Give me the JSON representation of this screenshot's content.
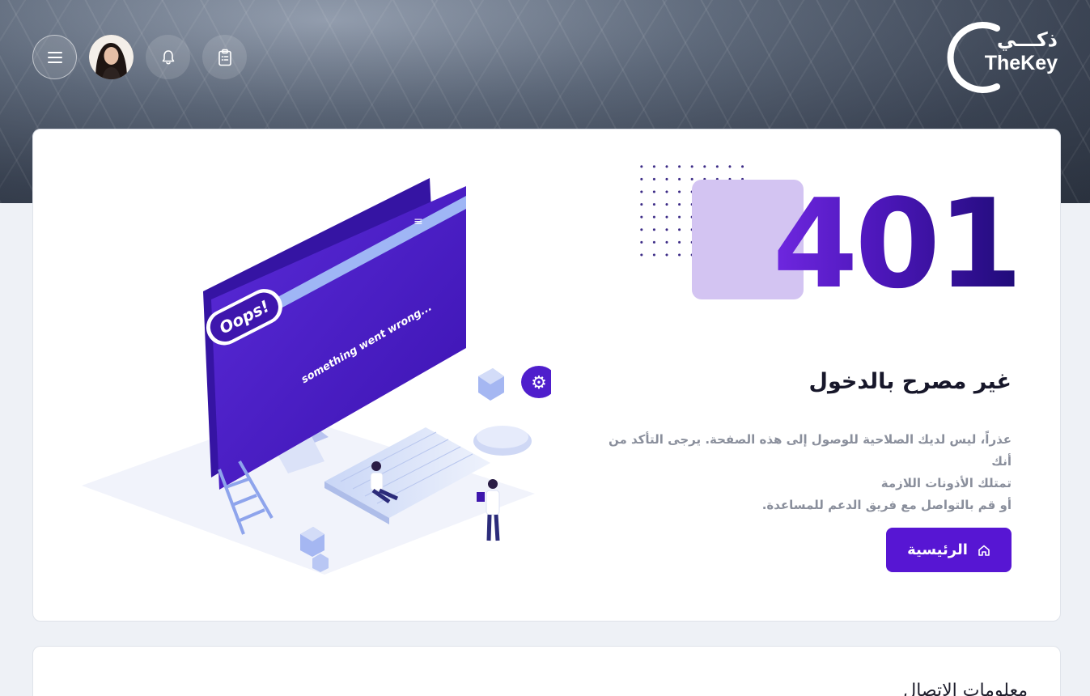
{
  "header": {
    "menu_icon": "hamburger-menu-icon",
    "notification_icon": "bell-icon",
    "tasks_icon": "clipboard-icon",
    "logo_ar": "ذكـــي",
    "logo_en": "TheKey"
  },
  "error": {
    "code": "401",
    "title": "غير مصرح بالدخول",
    "description_lines": [
      "عذراً، ليس لديك الصلاحية للوصول إلى هذه الصفحة. يرجى التأكد من أنك",
      "تمتلك الأذونات اللازمة",
      "أو قم بالتواصل مع فريق الدعم للمساعدة."
    ],
    "home_button_label": "الرئيسية",
    "home_icon": "home-icon"
  },
  "illustration": {
    "bubble_text": "Oops!",
    "screen_text": "something went wrong..."
  },
  "contact": {
    "title": "معلومات الاتصال"
  },
  "colors": {
    "primary": "#5716d3",
    "code_dark": "#1f0b78",
    "block_light": "#d3c4f2"
  }
}
